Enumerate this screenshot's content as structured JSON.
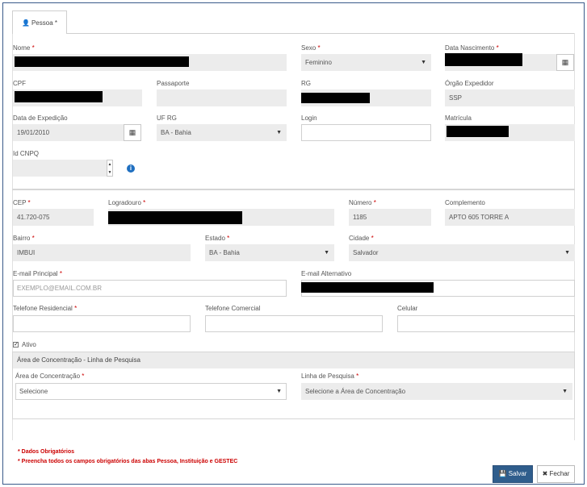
{
  "tab": {
    "label": "Pessoa *"
  },
  "fields": {
    "nome": {
      "label": "Nome",
      "req": "*"
    },
    "sexo": {
      "label": "Sexo",
      "req": "*",
      "value": "Feminino"
    },
    "nascimento": {
      "label": "Data Nascimento",
      "req": "*"
    },
    "cpf": {
      "label": "CPF"
    },
    "passaporte": {
      "label": "Passaporte"
    },
    "rg": {
      "label": "RG"
    },
    "orgao": {
      "label": "Órgão Expedidor",
      "value": "SSP"
    },
    "expedicao": {
      "label": "Data de Expedição",
      "value": "19/01/2010"
    },
    "ufrg": {
      "label": "UF RG",
      "value": "BA - Bahia"
    },
    "login": {
      "label": "Login"
    },
    "matricula": {
      "label": "Matrícula"
    },
    "cnpq": {
      "label": "Id CNPQ"
    },
    "cep": {
      "label": "CEP",
      "req": "*",
      "value": "41.720-075"
    },
    "logradouro": {
      "label": "Logradouro",
      "req": "*"
    },
    "numero": {
      "label": "Número",
      "req": "*",
      "value": "1185"
    },
    "complemento": {
      "label": "Complemento",
      "value": "APTO 605 TORRE A"
    },
    "bairro": {
      "label": "Bairro",
      "req": "*",
      "value": "IMBUI"
    },
    "estado": {
      "label": "Estado",
      "req": "*",
      "value": "BA - Bahia"
    },
    "cidade": {
      "label": "Cidade",
      "req": "*",
      "value": "Salvador"
    },
    "email_principal": {
      "label": "E-mail Principal",
      "req": "*",
      "placeholder": "EXEMPLO@EMAIL.COM.BR"
    },
    "email_alt": {
      "label": "E-mail Alternativo"
    },
    "tel_res": {
      "label": "Telefone Residencial",
      "req": "*"
    },
    "tel_com": {
      "label": "Telefone Comercial"
    },
    "celular": {
      "label": "Celular"
    }
  },
  "ativo": {
    "label": "Ativo",
    "checked": true
  },
  "concentracao_panel": {
    "title": "Área de Concentração - Linha de Pesquisa",
    "area": {
      "label": "Área de Concentração",
      "req": "*",
      "value": "Selecione"
    },
    "linha": {
      "label": "Linha de Pesquisa",
      "req": "*",
      "value": "Selecione a Área de Concentração"
    }
  },
  "notes": [
    "* Dados Obrigatórios",
    "* Preencha todos os campos obrigatórios das abas Pessoa, Instituição e GESTEC"
  ],
  "buttons": {
    "save": "Salvar",
    "close": "Fechar"
  },
  "icons": {
    "tab": "user-icon",
    "calendar": "calendar-icon",
    "info": "info-circle-icon",
    "save": "floppy-disk-icon",
    "close": "close-icon"
  }
}
